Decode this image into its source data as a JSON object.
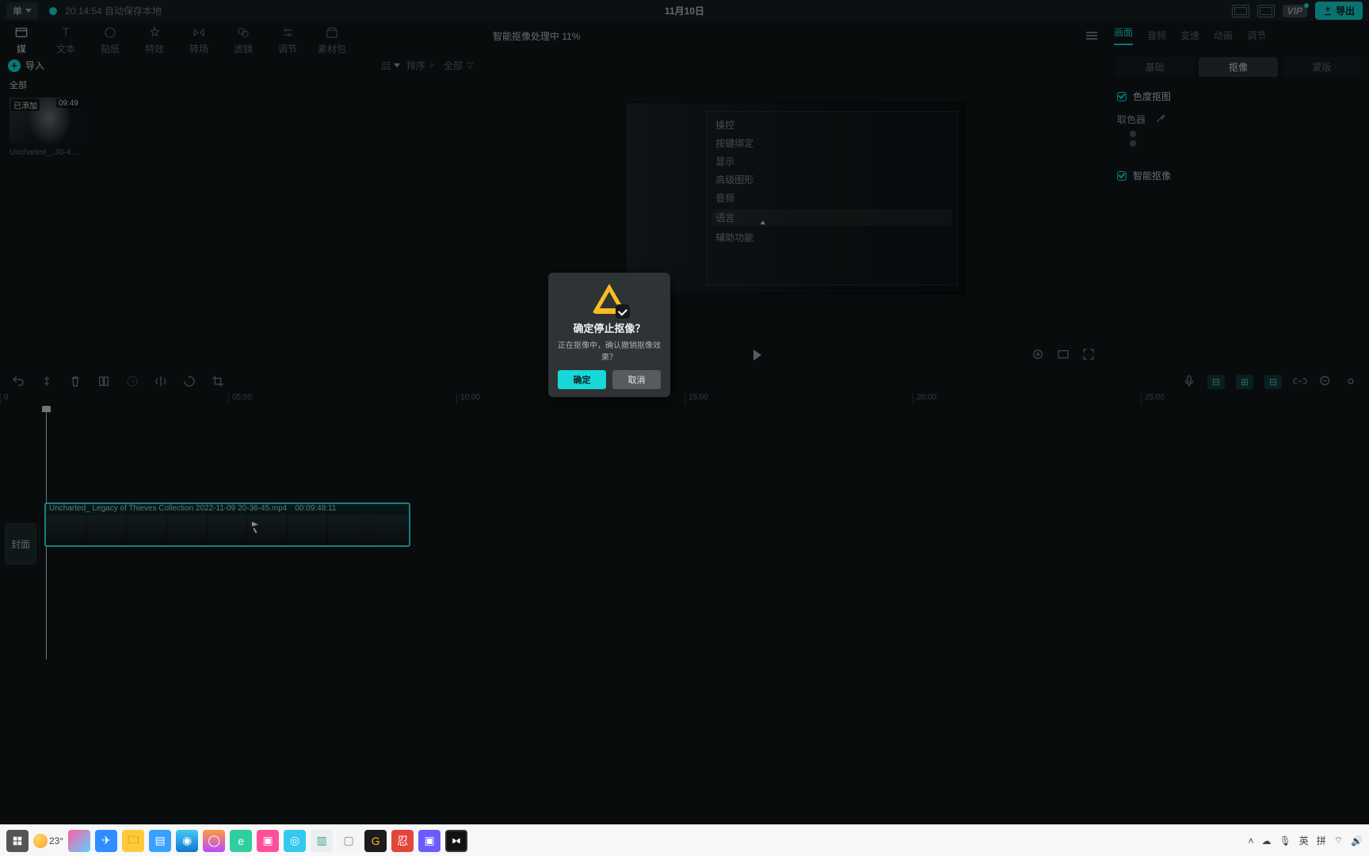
{
  "titlebar": {
    "menu": "单",
    "autosave": "20:14:54 自动保存本地",
    "date": "11月10日",
    "vip": "VIP",
    "export": "导出"
  },
  "pool": {
    "tabs": [
      "媒",
      "文本",
      "贴纸",
      "特效",
      "转场",
      "滤镜",
      "调节",
      "素材包"
    ],
    "import": "导入",
    "sort": "排序",
    "all_filter": "全部",
    "nav": "全部",
    "clip_badge": "已添加",
    "clip_duration": "09:49",
    "clip_name": "Uncharted_..36-45.mp4"
  },
  "preview": {
    "status": "智能抠像处理中 11%",
    "menu_items": [
      "操控",
      "按键绑定",
      "显示",
      "高级图形",
      "音频",
      "语言",
      "辅助功能"
    ]
  },
  "inspector": {
    "tabs": [
      "画面",
      "音频",
      "变速",
      "动画",
      "调节"
    ],
    "seg": [
      "基础",
      "抠像",
      "蒙版"
    ],
    "chroma": "色度抠图",
    "picker": "取色器",
    "smart": "智能抠像"
  },
  "timeline": {
    "marks": [
      "0",
      "05:00",
      "10:00",
      "15:00",
      "20:00",
      "25:00"
    ],
    "cover": "封面",
    "clip_title": "Uncharted_ Legacy of Thieves Collection 2022-11-09 20-36-45.mp4",
    "clip_time": "00:09:48:11"
  },
  "modal": {
    "title": "确定停止抠像？",
    "body": "正在抠像中，确认撤销抠像效果？",
    "ok": "确定",
    "cancel": "取消"
  },
  "taskbar": {
    "weather": "23°",
    "ime1": "英",
    "ime2": "拼"
  }
}
